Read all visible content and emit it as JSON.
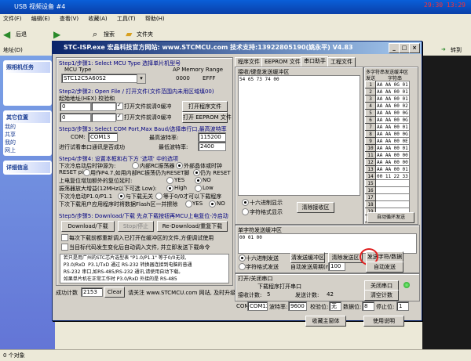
{
  "clock": "29:30 13:29",
  "explorer": {
    "title": "USB 视频设备 #4",
    "menu": [
      "文件(F)",
      "编辑(E)",
      "查看(V)",
      "收藏(A)",
      "工具(T)",
      "帮助(H)"
    ],
    "back": "后退",
    "search": "搜索",
    "folders": "文件夹",
    "address_label": "地址(D)",
    "goto": "转到",
    "tasks_title": "照相机任务",
    "other_title": "其它位置",
    "details_title": "详细信息",
    "other_items": [
      "我的",
      "共享",
      "我的",
      "网上"
    ],
    "status": "0 个对象"
  },
  "stc": {
    "title": "STC-ISP.exe    宏晶科技官方网站: www.STCMCU.com   技术支持:13922805190(姚永平)   V4.83",
    "step1": {
      "label": "Step1/步骤1: Select MCU Type  选择单片机型号",
      "mcu_type_label": "MCU Type",
      "ap_label": "AP Memory Range",
      "mcu": "STC12C5A60S2",
      "range_start": "0000",
      "range_end": "EFFF"
    },
    "step2": {
      "label": "Step2/步骤2: Open File / 打开文件(文件范围内未用区域填00)",
      "offset_label": "起始地址(HEX) 校验和",
      "addr1": "0",
      "addr2": "0",
      "clear1": "打开文件前清0缓冲",
      "clear2": "打开文件前清0缓冲",
      "open_prog": "打开程序文件",
      "open_eeprom": "打开 EEPROM 文件"
    },
    "step3": {
      "label": "Step3/步骤3: Select COM Port,Max Baud/选择串行口,最高波特率",
      "com_label": "COM:",
      "com": "COM13",
      "max_baud_label": "最高波特率:",
      "max_baud": "115200",
      "min_note": "进行试看串口通讯是否成功",
      "min_baud_label": "最低波特率:",
      "min_baud": "2400"
    },
    "step4": {
      "label": "Step4/步骤4: 设置本框和右下方 '选项' 中的选项",
      "clock_label": "下次冷启动后时钟源为:",
      "clock_int": "内部RC振荡器",
      "clock_ext": "外部晶体或时钟",
      "reset_label": "RESET pin",
      "reset_io": "用作P4.7,如用内部RC振荡仍为RESET脚",
      "reset_pin": "仍为 RESET",
      "power_label": "上电复位增加额外的复位延时:",
      "yes": "YES",
      "no": "NO",
      "amp_label": "振荡器放大增益(12MHz以下可选 Low):",
      "high": "High",
      "low": "Low",
      "p1_label": "下次冷启动P1.0/P1.1",
      "p1_a": "与下载无关",
      "p1_b": "等于0/0才可以下载程序",
      "eeprom_label": "下次下载用户应用程序时将数据Flash区一并擦除",
      "eeprom_yes": "YES",
      "eeprom_no": "NO"
    },
    "step5": {
      "label": "Step5/步骤5: Download/下载  先点下载按钮再MCU上电复位-冷启动",
      "download": "Download/下载",
      "stop": "Stop/停止",
      "redownload": "Re-Download/重复下载",
      "opt1": "每次下载前都重新调入已打开在缓冲区的文件,方便调试使用",
      "opt2": "当目标代码发生变化后自动调入文件, 并立即发送下载命令"
    },
    "log": "  若只是用广州的STC芯片选型表 \"P1.0/P1.1\" 等于0/0无效,\n  P3.0/RxD  P3.1/TxD 通过 RS-232 转换器连接到电脑的普通\n  RS-232 串口,如RS-485/RS-232 通讯,请使用自动下载。\n  如果单片机在正常工作时 P3.0/RxD 外接的是 RS-485",
    "tabs": [
      "程序文件",
      "EEPROM 文件",
      "串口助手",
      "工程文件"
    ],
    "active_tab": "串口助手",
    "recv_label": "接收/键盘发送缓冲区",
    "recv_text": "54 65 73 74 00",
    "hex_display": "十六进制显示",
    "char_display": "字符格式显示",
    "clear_recv": "清除接收区",
    "send_label": "单字符发送缓冲区",
    "send_text": "00 01 00",
    "hex_send": "十六进制发送",
    "char_send": "字符格式发送",
    "send_buf_btn": "清发送缓冲区",
    "auto_period_label": "自动发送周期(ms)",
    "auto_period": "100",
    "clear_send": "清除发送区",
    "send_data_btn": "发送字符/数据",
    "auto_send_btn": "自动发送",
    "multi_label": "多字符串发送缓冲区",
    "multi_head_send": "发送",
    "multi_head_str": "字符串",
    "multi_rows": [
      {
        "n": "1",
        "v": "AA AA 0G 01"
      },
      {
        "n": "2",
        "v": "AA AA 00 01"
      },
      {
        "n": "3",
        "v": "AA AA 00 01"
      },
      {
        "n": "4",
        "v": "AA AA 00 02"
      },
      {
        "n": "5",
        "v": "AA AA 00 0G"
      },
      {
        "n": "6",
        "v": "AA AA 00 0G"
      },
      {
        "n": "7",
        "v": "AA AA 00 01"
      },
      {
        "n": "8",
        "v": "AA AA 00 0G"
      },
      {
        "n": "9",
        "v": "AA AA 00 0E"
      },
      {
        "n": "10",
        "v": "AA AA 00 01"
      },
      {
        "n": "11",
        "v": "AA AA 00 00"
      },
      {
        "n": "12",
        "v": "AA AA 00 00"
      },
      {
        "n": "13",
        "v": "AA AA 00 01"
      },
      {
        "n": "14",
        "v": "00 11 22 33"
      },
      {
        "n": "15",
        "v": ""
      },
      {
        "n": "16",
        "v": ""
      },
      {
        "n": "17",
        "v": ""
      },
      {
        "n": "18",
        "v": ""
      },
      {
        "n": "19",
        "v": ""
      },
      {
        "n": "20",
        "v": ""
      }
    ],
    "multi_auto": "自动循环发送",
    "open_close_label": "打开/关闭串口",
    "download_open": "下载程序打开串口",
    "close_port": "关闭串口",
    "clear_count": "清空计数",
    "recv_count_label": "接收计数:",
    "recv_count": "5",
    "send_count_label": "发送计数:",
    "send_count": "42",
    "port_label": "COM:",
    "port": "COM12",
    "baud_label": "波特率:",
    "baud": "9600",
    "parity_label": "校验位:",
    "parity": "无",
    "data_bits_label": "数据位:",
    "data_bits": "8",
    "stop_label": "停止位:",
    "stop_bits": "1",
    "collect_btn": "收藏主窗体",
    "help_btn": "使用说明",
    "status_label": "成功计数",
    "status_count": "2153",
    "clear_btn": "Clear",
    "status_url": "请关注 www.STCMCU.com 网站, 及时升级"
  },
  "colors": {
    "titlebar": "#0a246a",
    "face": "#d4d0c8",
    "highlight": "#e02020",
    "led": "#1a9a1a"
  }
}
